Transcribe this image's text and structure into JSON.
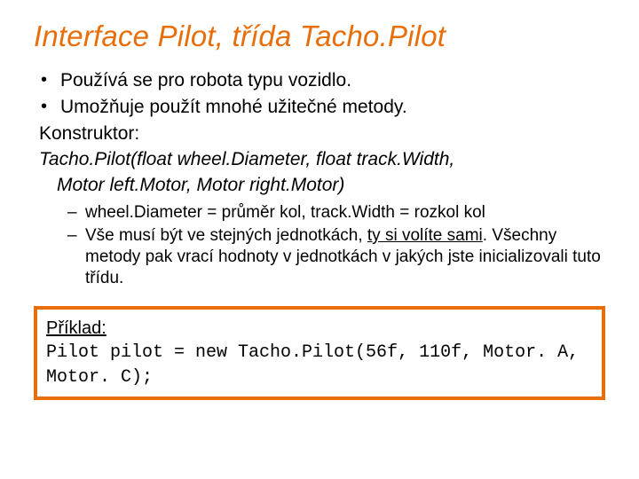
{
  "title": "Interface Pilot, třída Tacho.Pilot",
  "bullets": [
    "Používá se pro robota typu vozidlo.",
    "Umožňuje použít mnohé užitečné metody."
  ],
  "constructor_label": "Konstruktor:",
  "signature_line1": "Tacho.Pilot(float wheel.Diameter, float track.Width,",
  "signature_line2": "Motor left.Motor, Motor right.Motor)",
  "sub_bullets": {
    "item1": "wheel.Diameter = průměr kol, track.Width = rozkol kol",
    "item2_part1": "Vše musí být ve stejných jednotkách, ",
    "item2_underlined": "ty si volíte sami",
    "item2_part2": ". Všechny metody pak vrací hodnoty v jednotkách v jakých jste inicializovali tuto třídu."
  },
  "example": {
    "label": "Příklad:",
    "code": "Pilot pilot = new Tacho.Pilot(56f, 110f, Motor. A, Motor. C);"
  }
}
